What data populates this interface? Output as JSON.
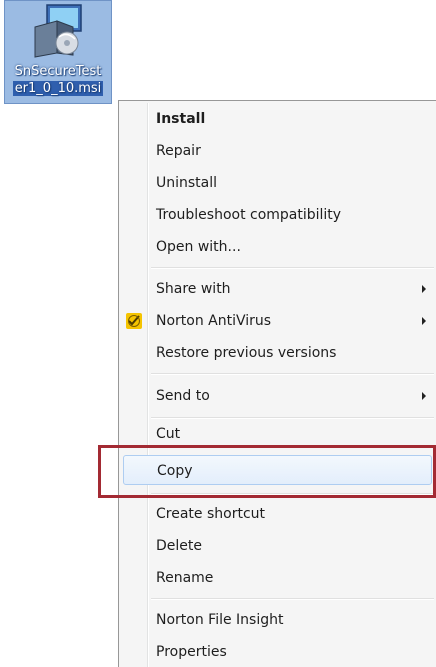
{
  "desktop": {
    "file": {
      "name_line1": "SnSecureTest",
      "name_line2": "er1_0_10.msi",
      "icon": "msi-installer-icon"
    }
  },
  "menu": {
    "items": [
      {
        "label": "Install",
        "bold": true
      },
      {
        "label": "Repair"
      },
      {
        "label": "Uninstall"
      },
      {
        "label": "Troubleshoot compatibility"
      },
      {
        "label": "Open with..."
      },
      {
        "label": "Share with",
        "submenu": true
      },
      {
        "label": "Norton AntiVirus",
        "submenu": true,
        "icon": "norton-icon"
      },
      {
        "label": "Restore previous versions"
      },
      {
        "label": "Send to",
        "submenu": true
      },
      {
        "label": "Cut"
      },
      {
        "label": "Copy",
        "highlighted": true
      },
      {
        "label": "Create shortcut"
      },
      {
        "label": "Delete"
      },
      {
        "label": "Rename"
      },
      {
        "label": "Norton File Insight"
      },
      {
        "label": "Properties"
      }
    ]
  },
  "annotation": {
    "highlight_color": "#a32a33",
    "target": "Copy"
  }
}
